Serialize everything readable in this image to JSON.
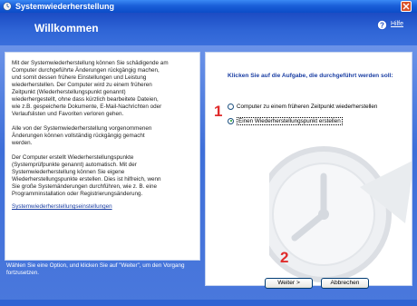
{
  "window": {
    "title": "Systemwiederherstellung",
    "colors": {
      "titlebar": "#0b4cc7",
      "header": "#2f65d6",
      "panel_bg": "#4a78dc",
      "link": "#1a3ea3",
      "annotation": "#e02b2b"
    }
  },
  "header": {
    "page_title": "Willkommen",
    "help_label": "Hilfe",
    "help_icon": "help-icon"
  },
  "left_panel": {
    "paragraphs": [
      "Mit der Systemwiederherstellung können Sie schädigende am\nComputer durchgeführte Änderungen rückgängig machen,\nund somit dessen frühere Einstellungen und Leistung\nwiederherstellen. Der Computer wird zu einem früheren\nZeitpunkt (Wiederherstellungspunkt genannt)\nwiederhergestellt, ohne dass kürzlich bearbeitete Dateien,\nwie z.B. gespeicherte Dokumente, E-Mail-Nachrichten oder\nVerlaufslisten und Favoriten verloren gehen.",
      "Alle von der Systemwiederherstellung vorgenommenen\nÄnderungen können vollständig rückgängig gemacht\nwerden.",
      "Der Computer erstellt Wiederherstellungspunkte\n(Systemprüfpunkte genannt) automatisch. Mit der\nSystemwiederherstellung können Sie eigene\nWiederherstellungspunkte erstellen. Dies ist hilfreich, wenn\nSie große Systemänderungen durchführen, wie z. B. eine\nProgramminstallation oder Registrierungsänderung."
    ],
    "settings_link": "Systemwiederherstellungseinstellungen"
  },
  "right_panel": {
    "heading": "Klicken Sie auf die Aufgabe, die durchgeführt werden soll:",
    "options": [
      {
        "label": "Computer zu einem früheren Zeitpunkt wiederherstellen",
        "selected": false
      },
      {
        "label": "Einen Wiederherstellungspunkt erstellen",
        "selected": true
      }
    ]
  },
  "footer": {
    "instruction": "Wählen Sie eine Option, und klicken Sie auf \"Weiter\", um den Vorgang fortzusetzen.",
    "next_label": "Weiter >",
    "cancel_label": "Abbrechen"
  },
  "annotations": {
    "step1": "1",
    "step2": "2"
  }
}
